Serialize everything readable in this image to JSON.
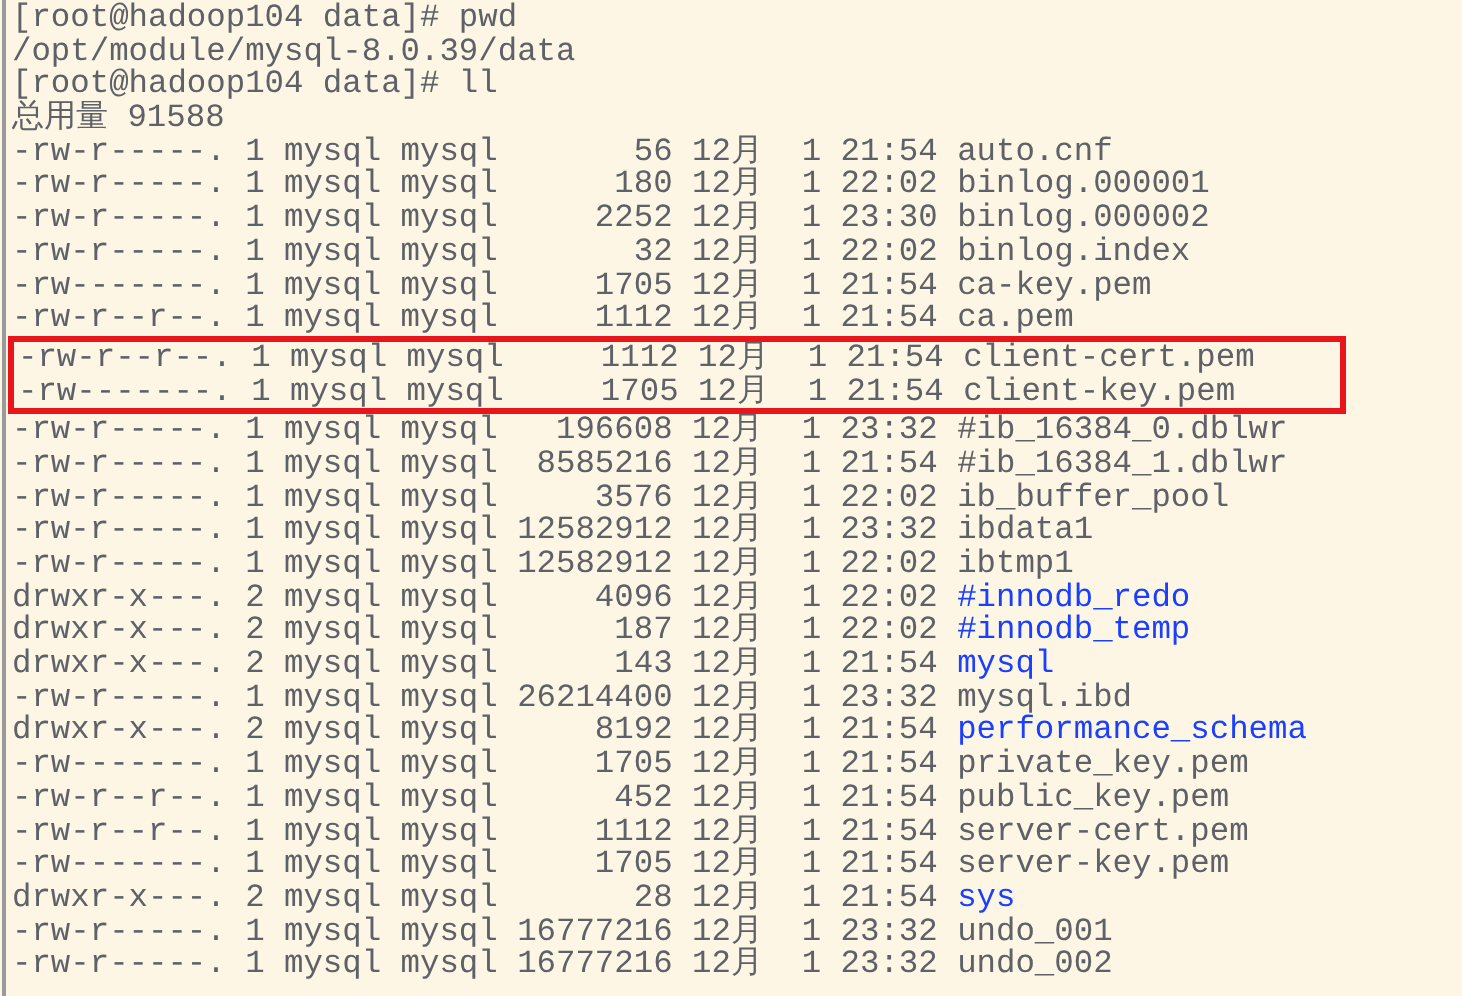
{
  "lines": [
    {
      "kind": "text",
      "text": "[root@hadoop104 data]# pwd"
    },
    {
      "kind": "text",
      "text": "/opt/module/mysql-8.0.39/data"
    },
    {
      "kind": "text",
      "text": "[root@hadoop104 data]# ll"
    },
    {
      "kind": "text",
      "text": "总用量 91588"
    },
    {
      "kind": "file",
      "info": "-rw-r-----. 1 mysql mysql       56 12月  1 21:54",
      "name": "auto.cnf",
      "highlighted": false
    },
    {
      "kind": "file",
      "info": "-rw-r-----. 1 mysql mysql      180 12月  1 22:02",
      "name": "binlog.000001",
      "highlighted": false
    },
    {
      "kind": "file",
      "info": "-rw-r-----. 1 mysql mysql     2252 12月  1 23:30",
      "name": "binlog.000002",
      "highlighted": false
    },
    {
      "kind": "file",
      "info": "-rw-r-----. 1 mysql mysql       32 12月  1 22:02",
      "name": "binlog.index",
      "highlighted": false
    },
    {
      "kind": "file",
      "info": "-rw-------. 1 mysql mysql     1705 12月  1 21:54",
      "name": "ca-key.pem",
      "highlighted": false
    },
    {
      "kind": "file",
      "info": "-rw-r--r--. 1 mysql mysql     1112 12月  1 21:54",
      "name": "ca.pem",
      "highlighted": false
    },
    {
      "kind": "file",
      "info": "-rw-r--r--. 1 mysql mysql     1112 12月  1 21:54",
      "name": "client-cert.pem",
      "highlighted": true
    },
    {
      "kind": "file",
      "info": "-rw-------. 1 mysql mysql     1705 12月  1 21:54",
      "name": "client-key.pem",
      "highlighted": true
    },
    {
      "kind": "file",
      "info": "-rw-r-----. 1 mysql mysql   196608 12月  1 23:32",
      "name": "#ib_16384_0.dblwr",
      "highlighted": false
    },
    {
      "kind": "file",
      "info": "-rw-r-----. 1 mysql mysql  8585216 12月  1 21:54",
      "name": "#ib_16384_1.dblwr",
      "highlighted": false
    },
    {
      "kind": "file",
      "info": "-rw-r-----. 1 mysql mysql     3576 12月  1 22:02",
      "name": "ib_buffer_pool",
      "highlighted": false
    },
    {
      "kind": "file",
      "info": "-rw-r-----. 1 mysql mysql 12582912 12月  1 23:32",
      "name": "ibdata1",
      "highlighted": false
    },
    {
      "kind": "file",
      "info": "-rw-r-----. 1 mysql mysql 12582912 12月  1 22:02",
      "name": "ibtmp1",
      "highlighted": false
    },
    {
      "kind": "dir",
      "info": "drwxr-x---. 2 mysql mysql     4096 12月  1 22:02",
      "name": "#innodb_redo",
      "highlighted": false
    },
    {
      "kind": "dir",
      "info": "drwxr-x---. 2 mysql mysql      187 12月  1 22:02",
      "name": "#innodb_temp",
      "highlighted": false
    },
    {
      "kind": "dir",
      "info": "drwxr-x---. 2 mysql mysql      143 12月  1 21:54",
      "name": "mysql",
      "highlighted": false
    },
    {
      "kind": "file",
      "info": "-rw-r-----. 1 mysql mysql 26214400 12月  1 23:32",
      "name": "mysql.ibd",
      "highlighted": false
    },
    {
      "kind": "dir",
      "info": "drwxr-x---. 2 mysql mysql     8192 12月  1 21:54",
      "name": "performance_schema",
      "highlighted": false
    },
    {
      "kind": "file",
      "info": "-rw-------. 1 mysql mysql     1705 12月  1 21:54",
      "name": "private_key.pem",
      "highlighted": false
    },
    {
      "kind": "file",
      "info": "-rw-r--r--. 1 mysql mysql      452 12月  1 21:54",
      "name": "public_key.pem",
      "highlighted": false
    },
    {
      "kind": "file",
      "info": "-rw-r--r--. 1 mysql mysql     1112 12月  1 21:54",
      "name": "server-cert.pem",
      "highlighted": false
    },
    {
      "kind": "file",
      "info": "-rw-------. 1 mysql mysql     1705 12月  1 21:54",
      "name": "server-key.pem",
      "highlighted": false
    },
    {
      "kind": "dir",
      "info": "drwxr-x---. 2 mysql mysql       28 12月  1 21:54",
      "name": "sys",
      "highlighted": false
    },
    {
      "kind": "file",
      "info": "-rw-r-----. 1 mysql mysql 16777216 12月  1 23:32",
      "name": "undo_001",
      "highlighted": false
    },
    {
      "kind": "file",
      "info": "-rw-r-----. 1 mysql mysql 16777216 12月  1 23:32",
      "name": "undo_002",
      "highlighted": false
    }
  ]
}
